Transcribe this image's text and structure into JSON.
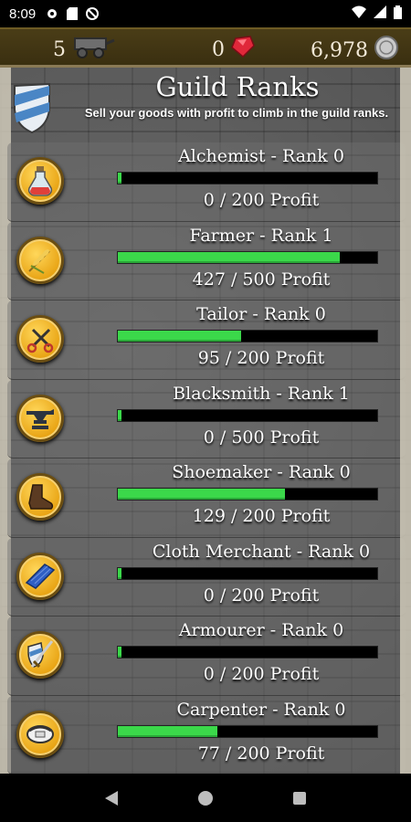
{
  "status_bar": {
    "time": "8:09",
    "icons": [
      "gear-icon",
      "sd-card-icon",
      "no-sync-icon"
    ],
    "right_icons": [
      "wifi-icon",
      "signal-icon",
      "battery-icon"
    ]
  },
  "resources": {
    "carts": "5",
    "gems": "0",
    "silver": "6,978"
  },
  "header": {
    "title": "Guild Ranks",
    "subtitle": "Sell your goods with profit to climb in the guild ranks."
  },
  "ranks": [
    {
      "label": "Alchemist - Rank 0",
      "profit_text": "0 / 200 Profit",
      "progress": 0.0,
      "icon": "potion-icon"
    },
    {
      "label": "Farmer - Rank 1",
      "profit_text": "427 / 500 Profit",
      "progress": 0.854,
      "icon": "wheat-icon"
    },
    {
      "label": "Tailor - Rank 0",
      "profit_text": "95 / 200 Profit",
      "progress": 0.475,
      "icon": "scissors-icon"
    },
    {
      "label": "Blacksmith - Rank 1",
      "profit_text": "0 / 500 Profit",
      "progress": 0.0,
      "icon": "anvil-icon"
    },
    {
      "label": "Shoemaker - Rank 0",
      "profit_text": "129 / 200 Profit",
      "progress": 0.645,
      "icon": "boot-icon"
    },
    {
      "label": "Cloth Merchant - Rank 0",
      "profit_text": "0 / 200 Profit",
      "progress": 0.0,
      "icon": "cloth-icon"
    },
    {
      "label": "Armourer - Rank 0",
      "profit_text": "0 / 200 Profit",
      "progress": 0.0,
      "icon": "sword-shield-icon"
    },
    {
      "label": "Carpenter - Rank 0",
      "profit_text": "77 / 200 Profit",
      "progress": 0.385,
      "icon": "saw-icon"
    }
  ],
  "colors": {
    "progress_fill": "#3bd84a",
    "resource_bar": "#3f3312",
    "medallion": "#e8a313"
  },
  "nav": [
    "back-icon",
    "home-icon",
    "recents-icon"
  ]
}
